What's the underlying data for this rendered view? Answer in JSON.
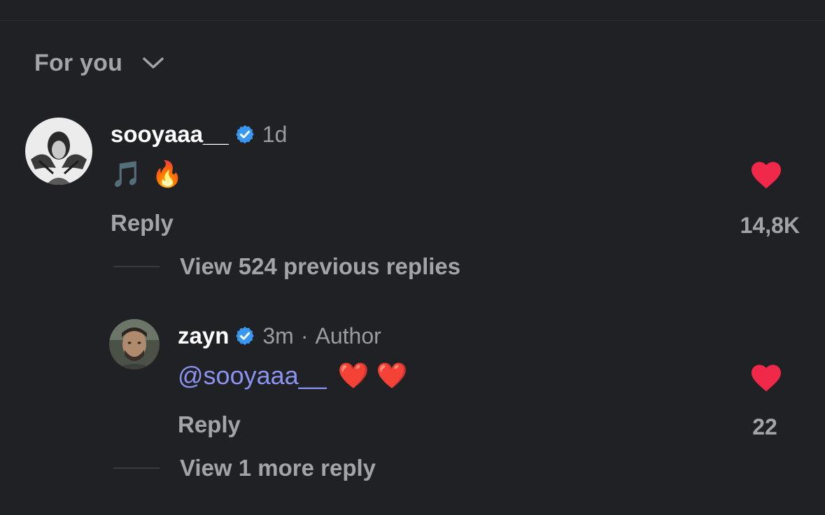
{
  "sort": {
    "label": "For you",
    "icon": "chevron-down-icon"
  },
  "comment": {
    "username": "sooyaaa__",
    "verified": true,
    "time": "1d",
    "body": [
      "🎵",
      "🔥"
    ],
    "reply_label": "Reply",
    "likes": "14,8K",
    "liked": true,
    "view_replies_label": "View 524 previous replies"
  },
  "reply": {
    "username": "zayn",
    "verified": true,
    "time": "3m",
    "separator": "·",
    "author_tag": "Author",
    "mention": "@sooyaaa__",
    "emojis": "❤️ ❤️",
    "reply_label": "Reply",
    "likes": "22",
    "liked": true,
    "view_more_label": "View 1 more reply"
  },
  "colors": {
    "background": "#202124",
    "heart": "#f02849",
    "verified": "#3897f0",
    "mention": "#8b93f0",
    "secondary_text": "#a2a4aa"
  }
}
